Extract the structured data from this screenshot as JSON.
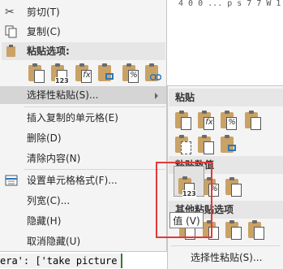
{
  "background": {
    "top_text": "4 0 0 ... p s 7 7 W 1 E",
    "bottom_text": "era': ['take picture"
  },
  "menu": {
    "cut": "剪切(T)",
    "copy": "复制(C)",
    "paste_options_header": "粘贴选项:",
    "paste_special": "选择性粘贴(S)...",
    "insert_copied": "插入复制的单元格(E)",
    "delete": "删除(D)",
    "clear": "清除内容(N)",
    "format_cells": "设置单元格格式(F)...",
    "column_width": "列宽(C)...",
    "hide": "隐藏(H)",
    "unhide": "取消隐藏(U)",
    "icons": {
      "cut": "scissors-icon",
      "copy": "copy-icon",
      "paste_header": "clipboard-icon",
      "format_cells": "format-cells-icon"
    },
    "paste_option_badges": [
      "",
      "123",
      "fx",
      "",
      "%",
      ""
    ]
  },
  "submenu": {
    "paste_header": "粘贴",
    "paste_values_header": "粘贴数值",
    "other_options_header": "其他粘贴选项",
    "paste_special": "选择性粘贴(S)...",
    "value_badges": [
      "123",
      "%",
      ""
    ],
    "paste_badges": [
      "",
      "fx",
      "%",
      "",
      "",
      "",
      ""
    ]
  },
  "tooltip": "值 (V)",
  "colors": {
    "accent_red": "#e53935",
    "menu_bg": "#f4f4f4",
    "highlight": "#d5d5d5"
  }
}
